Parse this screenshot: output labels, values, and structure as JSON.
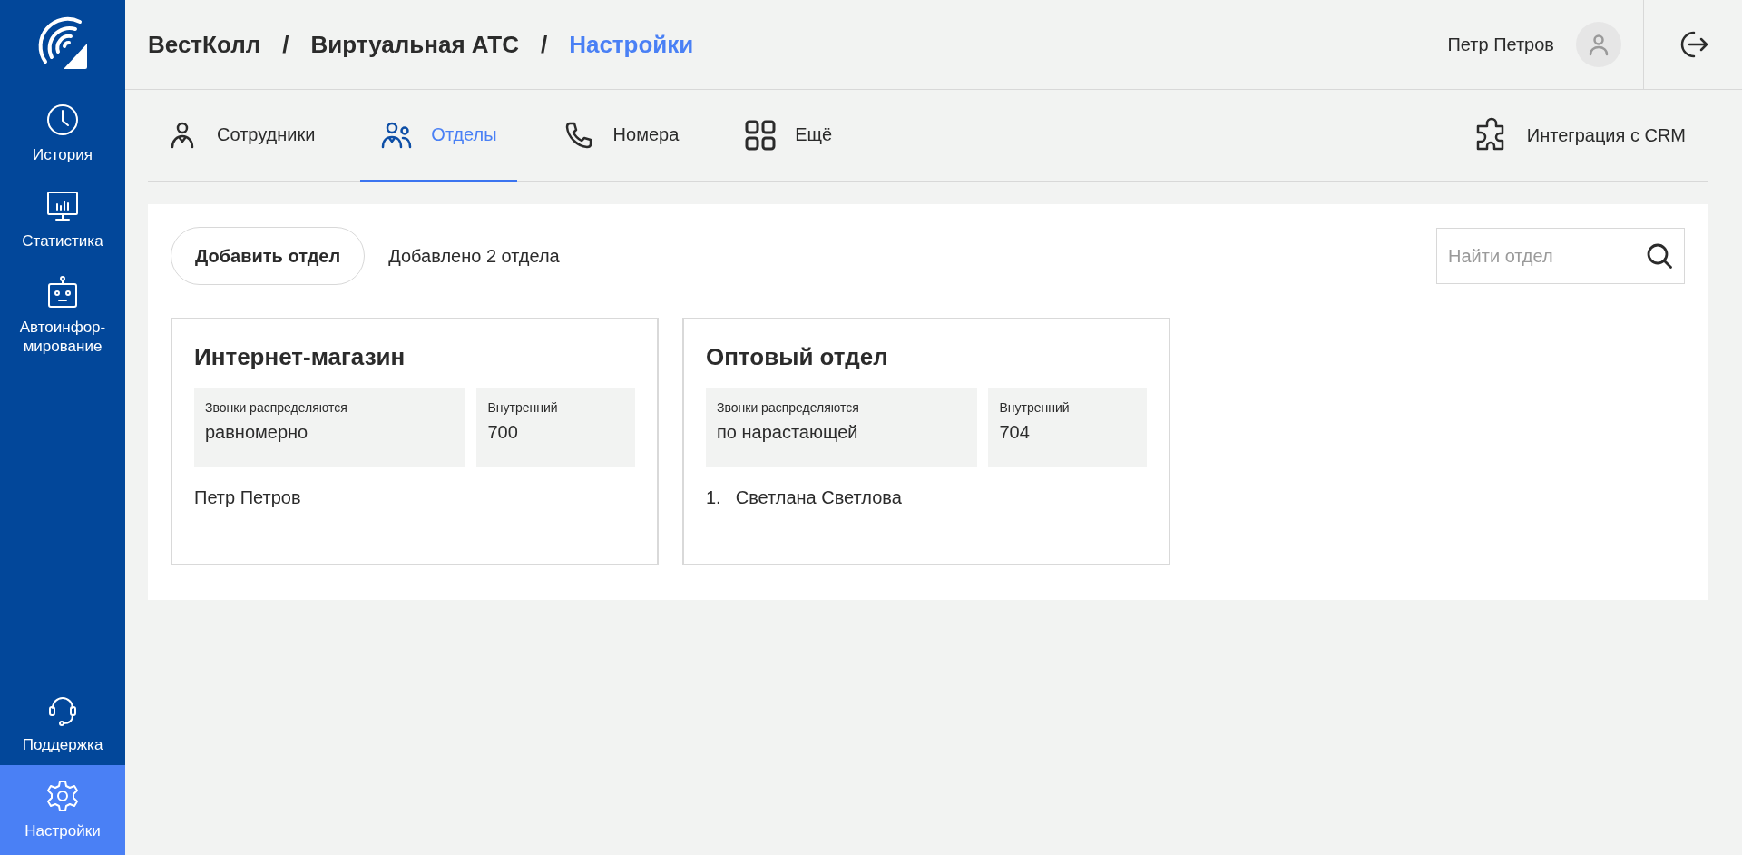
{
  "sidebar": {
    "items": [
      {
        "label": "История",
        "selected": false
      },
      {
        "label": "Статистика",
        "selected": false
      },
      {
        "label": "Автоинфор-\nмирование",
        "selected": false
      }
    ],
    "bottom_items": [
      {
        "label": "Поддержка",
        "selected": false
      },
      {
        "label": "Настройки",
        "selected": true
      }
    ]
  },
  "breadcrumbs": [
    {
      "label": "ВестКолл",
      "current": false
    },
    {
      "label": "Виртуальная АТС",
      "current": false
    },
    {
      "label": "Настройки",
      "current": true
    }
  ],
  "breadcrumb_separator": "/",
  "user": {
    "name": "Петр Петров"
  },
  "tabs": [
    {
      "label": "Сотрудники",
      "selected": false
    },
    {
      "label": "Отделы",
      "selected": true
    },
    {
      "label": "Номера",
      "selected": false
    },
    {
      "label": "Ещё",
      "selected": false
    }
  ],
  "integration_link": {
    "label": "Интеграция с CRM"
  },
  "toolbar": {
    "add_button": "Добавить отдел",
    "count_text": "Добавлено 2 отдела",
    "search": {
      "placeholder": "Найти отдел"
    }
  },
  "departments": [
    {
      "name": "Интернет-магазин",
      "distribution_label": "Звонки распределяются",
      "distribution": "равномерно",
      "extension_label": "Внутренний",
      "extension": "700",
      "members": [
        {
          "name": "Петр Петров"
        }
      ]
    },
    {
      "name": "Оптовый отдел",
      "distribution_label": "Звонки распределяются",
      "distribution": "по нарастающей",
      "extension_label": "Внутренний",
      "extension": "704",
      "members": [
        {
          "index": "1.",
          "name": "Светлана Светлова"
        }
      ]
    }
  ]
}
